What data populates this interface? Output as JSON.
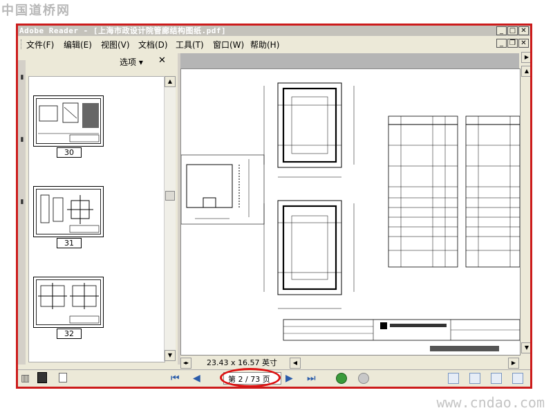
{
  "watermark": {
    "top": "中国道桥网",
    "bottom": "www.cndao.com"
  },
  "window": {
    "title": "Adobe Reader - [上海市政设计院管廊结构图纸.pdf]",
    "buttons": {
      "minimize": "_",
      "maximize": "□",
      "close": "✕",
      "restore": "❐"
    }
  },
  "menu": {
    "items": [
      "文件(F)",
      "编辑(E)",
      "视图(V)",
      "文档(D)",
      "工具(T)",
      "窗口(W)",
      "帮助(H)"
    ]
  },
  "nav_pane": {
    "options_label": "选项 ▾",
    "close_label": "✕",
    "thumbnails": [
      {
        "label": "30"
      },
      {
        "label": "31"
      },
      {
        "label": "32"
      }
    ]
  },
  "document": {
    "page_size": "23.43 x 16.57 英寸"
  },
  "status": {
    "page_text": "第 2 / 73 页",
    "current_page": "2",
    "total_pages": "73"
  },
  "colors": {
    "highlight": "#dd1111",
    "frame": "#cc1b1b",
    "accent": "#2a5caa"
  }
}
